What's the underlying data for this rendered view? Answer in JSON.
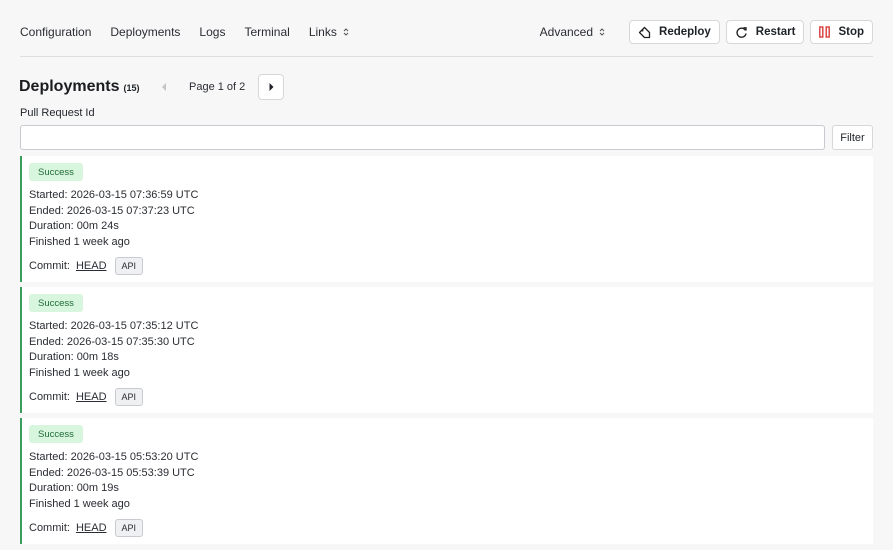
{
  "nav": {
    "items": [
      "Configuration",
      "Deployments",
      "Logs",
      "Terminal"
    ],
    "links_label": "Links",
    "advanced_label": "Advanced",
    "redeploy_label": "Redeploy",
    "restart_label": "Restart",
    "stop_label": "Stop"
  },
  "heading": {
    "title": "Deployments",
    "count": "(15)"
  },
  "pager": {
    "text": "Page 1 of 2"
  },
  "filter": {
    "label": "Pull Request Id",
    "value": "",
    "placeholder": "",
    "button_label": "Filter"
  },
  "deployments": [
    {
      "status": "Success",
      "started": "Started: 2026-03-15 07:36:59 UTC",
      "ended": "Ended: 2026-03-15 07:37:23 UTC",
      "duration": "Duration: 00m 24s",
      "finished": "Finished 1 week ago",
      "commit_label": "Commit:",
      "commit_ref": "HEAD",
      "tag": "API"
    },
    {
      "status": "Success",
      "started": "Started: 2026-03-15 07:35:12 UTC",
      "ended": "Ended: 2026-03-15 07:35:30 UTC",
      "duration": "Duration: 00m 18s",
      "finished": "Finished 1 week ago",
      "commit_label": "Commit:",
      "commit_ref": "HEAD",
      "tag": "API"
    },
    {
      "status": "Success",
      "started": "Started: 2026-03-15 05:53:20 UTC",
      "ended": "Ended: 2026-03-15 05:53:39 UTC",
      "duration": "Duration: 00m 19s",
      "finished": "Finished 1 week ago",
      "commit_label": "Commit:",
      "commit_ref": "HEAD",
      "tag": "API"
    }
  ],
  "colors": {
    "success_border": "#3a9d5b",
    "success_badge_bg": "#d8f5de",
    "stop_icon": "#d93a3a"
  },
  "icons": {
    "redeploy": "tag-icon",
    "restart": "refresh-icon",
    "stop": "stop-icon",
    "pager_prev": "caret-left-icon",
    "pager_next": "caret-right-icon"
  }
}
